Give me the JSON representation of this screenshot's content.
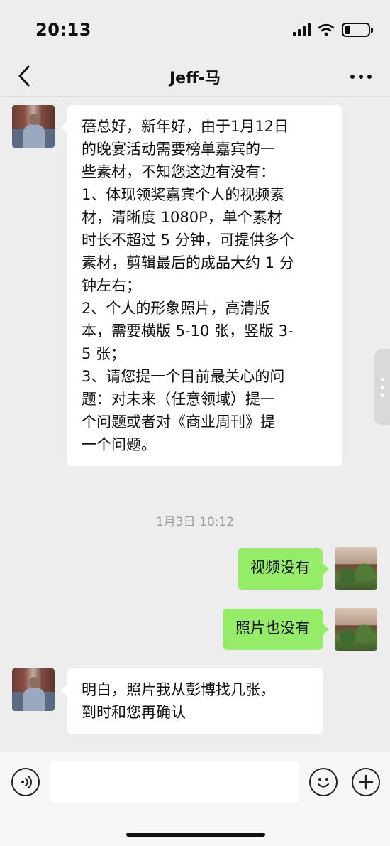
{
  "status_bar": {
    "time": "20:13",
    "icons": [
      "signal-icon",
      "wifi-icon",
      "battery-icon"
    ],
    "battery_level": 0.25
  },
  "nav": {
    "title": "Jeff-马",
    "back_icon": "chevron-left-icon",
    "more_icon": "more-dots-icon"
  },
  "messages": [
    {
      "sender": "left",
      "lines": [
        "蓓总好，新年好，由于1月12日",
        "的晚宴活动需要榜单嘉宾的一",
        "些素材，不知您这边有没有：",
        "1、体现领奖嘉宾个人的视频素",
        "材，清晰度 1080P，单个素材",
        "时长不超过 5 分钟，可提供多个",
        "素材，剪辑最后的成品大约 1 分",
        "钟左右；",
        "2、个人的形象照片，高清版",
        "本，需要横版 5-10 张，竖版 3-",
        "5 张；",
        "3、请您提一个目前最关心的问",
        "题：对未来（任意领域）提一",
        "个问题或者对《商业周刊》提",
        "一个问题。"
      ]
    },
    {
      "sender": "right",
      "text": "视频没有"
    },
    {
      "sender": "right",
      "text": "照片也没有"
    },
    {
      "sender": "left",
      "lines": [
        "明白，照片我从彭博找几张，",
        "到时和您再确认"
      ]
    }
  ],
  "timestamp": "1月3日 10:12",
  "input_bar": {
    "voice_icon": "voice-icon",
    "input_value": "",
    "emoji_icon": "emoji-icon",
    "plus_icon": "plus-icon"
  },
  "colors": {
    "background": "#ededed",
    "bubble_left": "#ffffff",
    "bubble_right": "#95ec69",
    "timestamp": "#9a9a9a"
  }
}
